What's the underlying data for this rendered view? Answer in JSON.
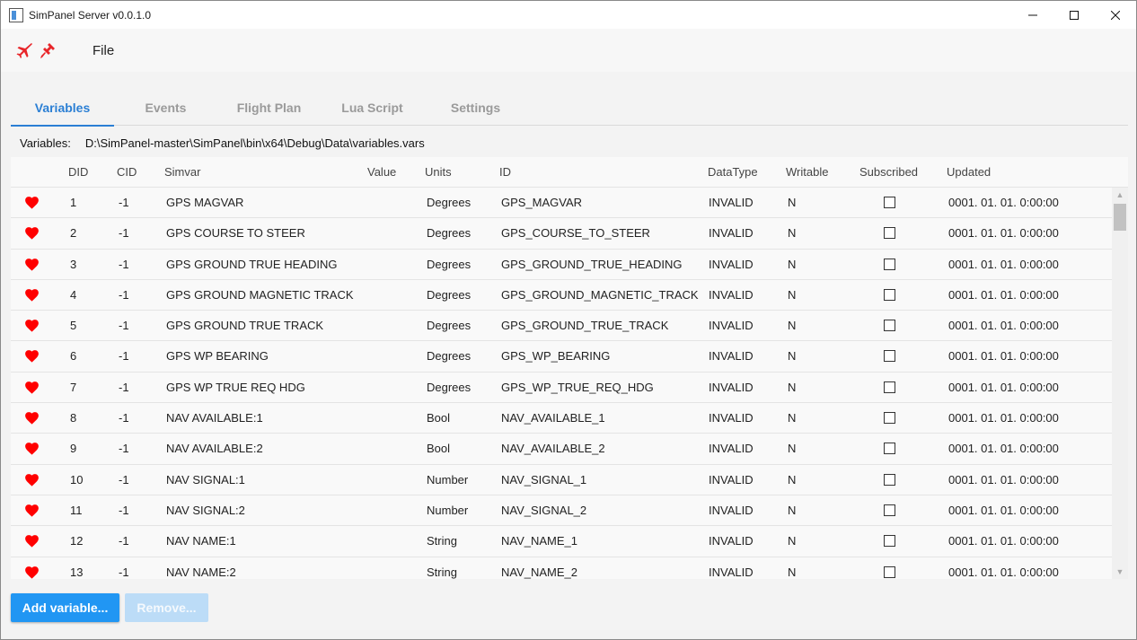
{
  "window": {
    "title": "SimPanel Server v0.0.1.0"
  },
  "menu": {
    "file_label": "File",
    "icons": [
      "airplane-icon",
      "plug-icon"
    ],
    "icon_color": "#e8262a"
  },
  "tabs": [
    {
      "label": "Variables",
      "active": true
    },
    {
      "label": "Events",
      "active": false
    },
    {
      "label": "Flight Plan",
      "active": false
    },
    {
      "label": "Lua Script",
      "active": false
    },
    {
      "label": "Settings",
      "active": false
    }
  ],
  "file_path": {
    "label": "Variables:",
    "value": "D:\\SimPanel-master\\SimPanel\\bin\\x64\\Debug\\Data\\variables.vars"
  },
  "table": {
    "columns": [
      "DID",
      "CID",
      "Simvar",
      "Value",
      "Units",
      "ID",
      "DataType",
      "Writable",
      "Subscribed",
      "Updated"
    ],
    "rows": [
      {
        "did": "1",
        "cid": "-1",
        "simvar": "GPS MAGVAR",
        "value": "",
        "units": "Degrees",
        "id": "GPS_MAGVAR",
        "datatype": "INVALID",
        "writable": "N",
        "subscribed": false,
        "updated": "0001. 01. 01. 0:00:00"
      },
      {
        "did": "2",
        "cid": "-1",
        "simvar": "GPS COURSE TO STEER",
        "value": "",
        "units": "Degrees",
        "id": "GPS_COURSE_TO_STEER",
        "datatype": "INVALID",
        "writable": "N",
        "subscribed": false,
        "updated": "0001. 01. 01. 0:00:00"
      },
      {
        "did": "3",
        "cid": "-1",
        "simvar": "GPS GROUND TRUE HEADING",
        "value": "",
        "units": "Degrees",
        "id": "GPS_GROUND_TRUE_HEADING",
        "datatype": "INVALID",
        "writable": "N",
        "subscribed": false,
        "updated": "0001. 01. 01. 0:00:00"
      },
      {
        "did": "4",
        "cid": "-1",
        "simvar": "GPS GROUND MAGNETIC TRACK",
        "value": "",
        "units": "Degrees",
        "id": "GPS_GROUND_MAGNETIC_TRACK",
        "datatype": "INVALID",
        "writable": "N",
        "subscribed": false,
        "updated": "0001. 01. 01. 0:00:00"
      },
      {
        "did": "5",
        "cid": "-1",
        "simvar": "GPS GROUND TRUE TRACK",
        "value": "",
        "units": "Degrees",
        "id": "GPS_GROUND_TRUE_TRACK",
        "datatype": "INVALID",
        "writable": "N",
        "subscribed": false,
        "updated": "0001. 01. 01. 0:00:00"
      },
      {
        "did": "6",
        "cid": "-1",
        "simvar": "GPS WP BEARING",
        "value": "",
        "units": "Degrees",
        "id": "GPS_WP_BEARING",
        "datatype": "INVALID",
        "writable": "N",
        "subscribed": false,
        "updated": "0001. 01. 01. 0:00:00"
      },
      {
        "did": "7",
        "cid": "-1",
        "simvar": "GPS WP TRUE REQ HDG",
        "value": "",
        "units": "Degrees",
        "id": "GPS_WP_TRUE_REQ_HDG",
        "datatype": "INVALID",
        "writable": "N",
        "subscribed": false,
        "updated": "0001. 01. 01. 0:00:00"
      },
      {
        "did": "8",
        "cid": "-1",
        "simvar": "NAV AVAILABLE:1",
        "value": "",
        "units": "Bool",
        "id": "NAV_AVAILABLE_1",
        "datatype": "INVALID",
        "writable": "N",
        "subscribed": false,
        "updated": "0001. 01. 01. 0:00:00"
      },
      {
        "did": "9",
        "cid": "-1",
        "simvar": "NAV AVAILABLE:2",
        "value": "",
        "units": "Bool",
        "id": "NAV_AVAILABLE_2",
        "datatype": "INVALID",
        "writable": "N",
        "subscribed": false,
        "updated": "0001. 01. 01. 0:00:00"
      },
      {
        "did": "10",
        "cid": "-1",
        "simvar": "NAV SIGNAL:1",
        "value": "",
        "units": "Number",
        "id": "NAV_SIGNAL_1",
        "datatype": "INVALID",
        "writable": "N",
        "subscribed": false,
        "updated": "0001. 01. 01. 0:00:00"
      },
      {
        "did": "11",
        "cid": "-1",
        "simvar": "NAV SIGNAL:2",
        "value": "",
        "units": "Number",
        "id": "NAV_SIGNAL_2",
        "datatype": "INVALID",
        "writable": "N",
        "subscribed": false,
        "updated": "0001. 01. 01. 0:00:00"
      },
      {
        "did": "12",
        "cid": "-1",
        "simvar": "NAV NAME:1",
        "value": "",
        "units": "String",
        "id": "NAV_NAME_1",
        "datatype": "INVALID",
        "writable": "N",
        "subscribed": false,
        "updated": "0001. 01. 01. 0:00:00"
      },
      {
        "did": "13",
        "cid": "-1",
        "simvar": "NAV NAME:2",
        "value": "",
        "units": "String",
        "id": "NAV_NAME_2",
        "datatype": "INVALID",
        "writable": "N",
        "subscribed": false,
        "updated": "0001. 01. 01. 0:00:00"
      }
    ],
    "row_icon": "heart-icon",
    "row_icon_color": "#ff0000"
  },
  "buttons": {
    "add_label": "Add variable...",
    "remove_label": "Remove..."
  },
  "colors": {
    "accent": "#2b7fd4",
    "primary_button": "#2196f3"
  }
}
